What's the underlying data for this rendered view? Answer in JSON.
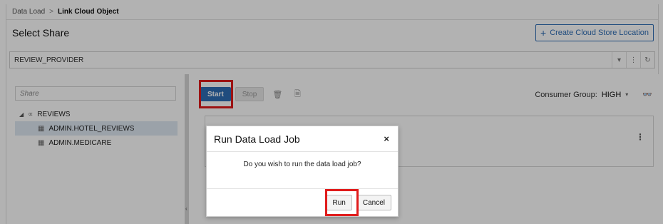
{
  "breadcrumb": {
    "parent": "Data Load",
    "separator": ">",
    "current": "Link Cloud Object"
  },
  "header": {
    "title": "Select Share",
    "create_button_label": "Create Cloud Store Location"
  },
  "share_selector": {
    "selected_value": "REVIEW_PROVIDER"
  },
  "left_panel": {
    "filter_placeholder": "Share",
    "tree": {
      "root": {
        "label": "REVIEWS",
        "expanded": true
      },
      "children": [
        {
          "label": "ADMIN.HOTEL_REVIEWS",
          "selected": true
        },
        {
          "label": "ADMIN.MEDICARE",
          "selected": false
        }
      ]
    }
  },
  "toolbar": {
    "start_label": "Start",
    "stop_label": "Stop"
  },
  "consumer_group": {
    "label": "Consumer Group:",
    "value": "HIGH"
  },
  "dialog": {
    "title": "Run Data Load Job",
    "message": "Do you wish to run the data load job?",
    "run_label": "Run",
    "cancel_label": "Cancel"
  },
  "colors": {
    "primary": "#2f6db5",
    "highlight": "#e01b1b",
    "selected_row": "#dfe8f3"
  },
  "icons": [
    "chevron-right-icon",
    "plus-icon",
    "dropdown-arrow-icon",
    "kebab-icon",
    "refresh-icon",
    "share-icon",
    "table-icon",
    "trash-icon",
    "document-icon",
    "glasses-icon",
    "close-icon",
    "splitter-grip-icon"
  ]
}
